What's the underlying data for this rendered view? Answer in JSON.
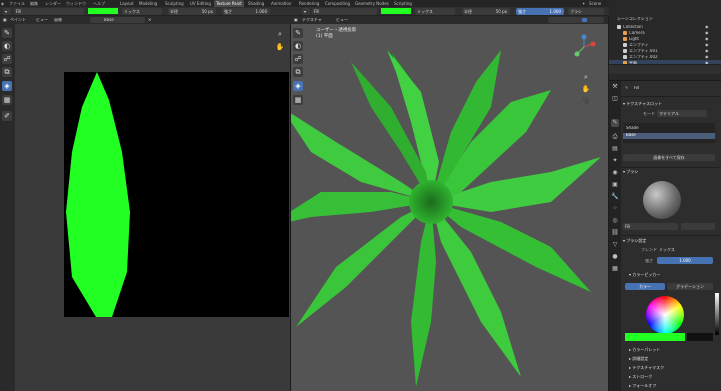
{
  "menu": [
    "ファイル",
    "編集",
    "レンダー",
    "ウィンドウ",
    "ヘルプ"
  ],
  "workspace_tabs": [
    {
      "label": "Layout",
      "active": false
    },
    {
      "label": "Modeling",
      "active": false
    },
    {
      "label": "Sculpting",
      "active": false
    },
    {
      "label": "UV Editing",
      "active": false
    },
    {
      "label": "Texture Paint",
      "active": true
    },
    {
      "label": "Shading",
      "active": false
    },
    {
      "label": "Animation",
      "active": false
    },
    {
      "label": "Rendering",
      "active": false
    },
    {
      "label": "Compositing",
      "active": false
    },
    {
      "label": "Geometry Nodes",
      "active": false
    },
    {
      "label": "Scripting",
      "active": false
    }
  ],
  "scene": {
    "label": "Scene",
    "view_layer": "View Layer"
  },
  "header_left": {
    "brush_name": "Fill",
    "blend_mode": "ミックス",
    "radius_label": "半径",
    "radius_value": "50 px",
    "strength_label": "強さ",
    "strength_value": "1.000"
  },
  "header_right": {
    "brush_name": "Fill",
    "blend_mode": "ミックス",
    "radius_label": "半径",
    "radius_value": "50 px",
    "strength_label": "強さ",
    "strength_value": "1.000",
    "brush_menu": "ブラシ"
  },
  "image_editor_header": {
    "mode": "ペイント",
    "view": "ビュー",
    "image_menu": "画像",
    "image_name": "Base"
  },
  "viewport_header": {
    "mode": "テクスチャ",
    "view": "ビュー"
  },
  "viewport_overlay": {
    "line1": "ユーザー・透視投影",
    "line2": "(1) 平面"
  },
  "outliner": {
    "title": "シーンコレクション",
    "rows": [
      {
        "label": "Collection",
        "indent": 0,
        "selected": false,
        "color": "#cfcfcf"
      },
      {
        "label": "Camera",
        "indent": 1,
        "selected": false,
        "color": "#e8a04c"
      },
      {
        "label": "Light",
        "indent": 1,
        "selected": false,
        "color": "#e8a04c"
      },
      {
        "label": "エンプティ",
        "indent": 1,
        "selected": false,
        "color": "#cfcfcf"
      },
      {
        "label": "エンプティ.001",
        "indent": 1,
        "selected": false,
        "color": "#cfcfcf"
      },
      {
        "label": "エンプティ.002",
        "indent": 1,
        "selected": false,
        "color": "#cfcfcf"
      },
      {
        "label": "平面",
        "indent": 1,
        "selected": true,
        "color": "#e8a04c"
      }
    ]
  },
  "properties": {
    "search_placeholder": "",
    "brush_name": "Fill",
    "texture_slots_title": "テクスチャスロット",
    "mode_label": "モード",
    "mode_value": "マテリアル",
    "slots": [
      {
        "label": "Shade",
        "selected": false
      },
      {
        "label": "Base",
        "selected": true
      }
    ],
    "save_all_button": "画像をすべて保存",
    "brush_section": "ブラシ",
    "brush_field": "Fill",
    "brush_settings_title": "ブラシ設定",
    "blend_label": "ブレンド",
    "blend_value": "ミックス",
    "strength_label": "強さ",
    "strength_value": "1.000",
    "color_picker_title": "カラーピッカー",
    "color_tabs": [
      {
        "label": "カラー",
        "active": true
      },
      {
        "label": "グラデーション",
        "active": false
      }
    ],
    "color_swatch": "#22ff22",
    "collapsed_sections": [
      "カラーパレット",
      "詳細設定",
      "テクスチャマスク",
      "ストローク",
      "フォールオフ"
    ]
  },
  "colors": {
    "accent": "#4772b3",
    "paint": "#22ff22"
  }
}
